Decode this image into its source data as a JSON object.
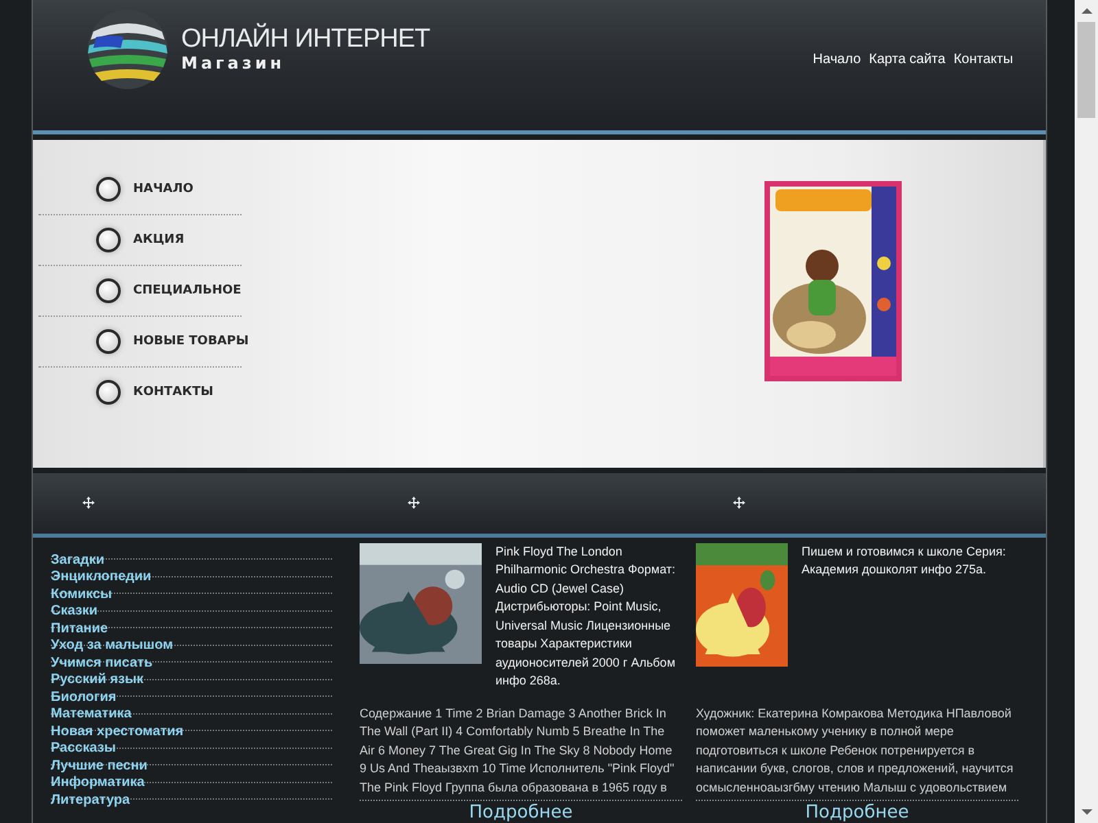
{
  "header": {
    "logo_title": "ОНЛАЙН ИНТЕРНЕТ",
    "logo_subtitle": "Магазин",
    "nav": [
      "Начало",
      "Карта сайта",
      "Контакты"
    ]
  },
  "menu": [
    "НАЧАЛО",
    "АКЦИЯ",
    "СПЕЦИАЛЬНОЕ",
    "НОВЫЕ ТОВАРЫ",
    "КОНТАКТЫ"
  ],
  "categories": [
    "Загадки",
    "Энциклопедии",
    "Комиксы",
    "Сказки",
    "Питание",
    "Уход за малышом",
    "Учимся писать",
    "Русский язык",
    "Биология",
    "Математика",
    "Новая хрестоматия",
    "Рассказы",
    "Лучшие песни",
    "Информатика",
    "Литература"
  ],
  "products": [
    {
      "summary": "Pink Floyd The London Philharmonic Orchestra Формат: Audio CD (Jewel Case) Дистрибьюторы: Point Music, Universal Music Лицензионные товары Характеристики аудионосителей 2000 г Альбом инфо 268а.",
      "details": "Содержание 1 Time 2 Brian Damage 3 Another Brick In The Wall (Part II) 4 Comfortably Numb 5 Breathe In The Air 6 Money 7 The Great Gig In The Sky 8 Nobody Home 9 Us And Theаызвхm 10 Time Исполнитель \"Pink Floyd\" The Pink Floyd Группа была образована в 1965 году в",
      "more": "Подробнее"
    },
    {
      "summary": "Пишем и готовимся к школе Серия: Академия дошколят инфо 275а.",
      "details": "Художник: Екатерина Комракова Методика НПавловой поможет маленькому ученику в полной мере подготовиться к школе Ребенок потренируется в написании букв, слогов, слов и предложений, научится осмысленноаызгбму чтению Малыш с удовольствием",
      "more": "Подробнее"
    }
  ]
}
